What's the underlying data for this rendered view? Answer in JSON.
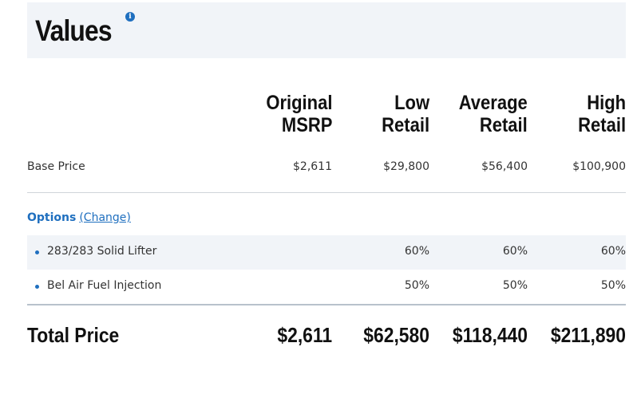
{
  "header": {
    "title": "Values",
    "info_icon": "info-icon"
  },
  "columns": [
    {
      "line1": "Original",
      "line2": "MSRP"
    },
    {
      "line1": "Low",
      "line2": "Retail"
    },
    {
      "line1": "Average",
      "line2": "Retail"
    },
    {
      "line1": "High",
      "line2": "Retail"
    }
  ],
  "base": {
    "label": "Base Price",
    "values": [
      "$2,611",
      "$29,800",
      "$56,400",
      "$100,900"
    ]
  },
  "options": {
    "title": "Options",
    "change_link": "(Change)",
    "items": [
      {
        "label": "283/283 Solid Lifter",
        "values": [
          "",
          "60%",
          "60%",
          "60%"
        ]
      },
      {
        "label": "Bel Air Fuel Injection",
        "values": [
          "",
          "50%",
          "50%",
          "50%"
        ]
      }
    ]
  },
  "total": {
    "label": "Total Price",
    "values": [
      "$2,611",
      "$62,580",
      "$118,440",
      "$211,890"
    ]
  },
  "colors": {
    "accent": "#1f6fbf",
    "band": "#f1f4f8"
  }
}
